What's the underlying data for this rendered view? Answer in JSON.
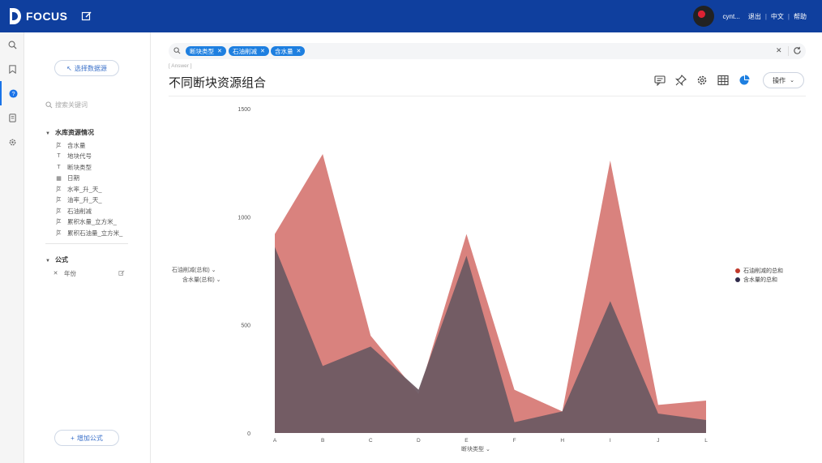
{
  "header": {
    "brand": "FOCUS",
    "user_name": "cynt...",
    "logout": "退出",
    "language": "中文",
    "help": "帮助",
    "bg_color": "#0f3f9e"
  },
  "iconbar": {
    "items": [
      {
        "icon": "search-icon"
      },
      {
        "icon": "bookmark-icon"
      },
      {
        "icon": "help-icon",
        "active": true
      },
      {
        "icon": "database-icon"
      },
      {
        "icon": "settings-icon"
      }
    ]
  },
  "sidebar": {
    "select_source": "选择数据源",
    "search_placeholder": "搜索关键词",
    "group1": {
      "title": "水库资源情况",
      "fields": [
        {
          "icon": "measure-icon",
          "glyph": "ʃΣ",
          "label": "含水量"
        },
        {
          "icon": "attribute-icon",
          "glyph": "T",
          "label": "地块代号"
        },
        {
          "icon": "attribute-icon",
          "glyph": "T",
          "label": "断块类型"
        },
        {
          "icon": "calendar-icon",
          "glyph": "▦",
          "label": "日期"
        },
        {
          "icon": "measure-icon",
          "glyph": "ʃΣ",
          "label": "水率_升_天_"
        },
        {
          "icon": "measure-icon",
          "glyph": "ʃΣ",
          "label": "油率_升_天_"
        },
        {
          "icon": "measure-icon",
          "glyph": "ʃΣ",
          "label": "石油削减"
        },
        {
          "icon": "measure-icon",
          "glyph": "ʃΣ",
          "label": "累积水量_立方米_"
        },
        {
          "icon": "measure-icon",
          "glyph": "ʃΣ",
          "label": "累积石油量_立方米_"
        }
      ]
    },
    "group2": {
      "title": "公式",
      "items": [
        {
          "label": "年份"
        }
      ]
    },
    "add_formula": "增加公式"
  },
  "search": {
    "tokens": [
      "断块类型",
      "石油削减",
      "含水量"
    ]
  },
  "answer_tag": "[ Answer ]",
  "title": "不同断块资源组合",
  "operate_button": "操作",
  "accent_color": "#1e7fe0",
  "chart_data": {
    "type": "area",
    "categories": [
      "A",
      "B",
      "C",
      "D",
      "E",
      "F",
      "H",
      "I",
      "J",
      "L"
    ],
    "series": [
      {
        "name": "石油削减的总和",
        "color": "#d9827e",
        "values": [
          920,
          1290,
          450,
          180,
          920,
          200,
          100,
          1260,
          130,
          150
        ]
      },
      {
        "name": "含水量的总和",
        "color": "#6e5a63",
        "values": [
          860,
          310,
          400,
          200,
          820,
          50,
          100,
          610,
          90,
          60
        ]
      }
    ],
    "y_ticks": [
      0,
      500,
      1000,
      1500
    ],
    "ylim": [
      0,
      1500
    ],
    "y_axis_labels": [
      "石油削减(总和)",
      "含水量(总和)"
    ],
    "xlabel": "断块类型",
    "legend_position": "right",
    "grid": false
  }
}
